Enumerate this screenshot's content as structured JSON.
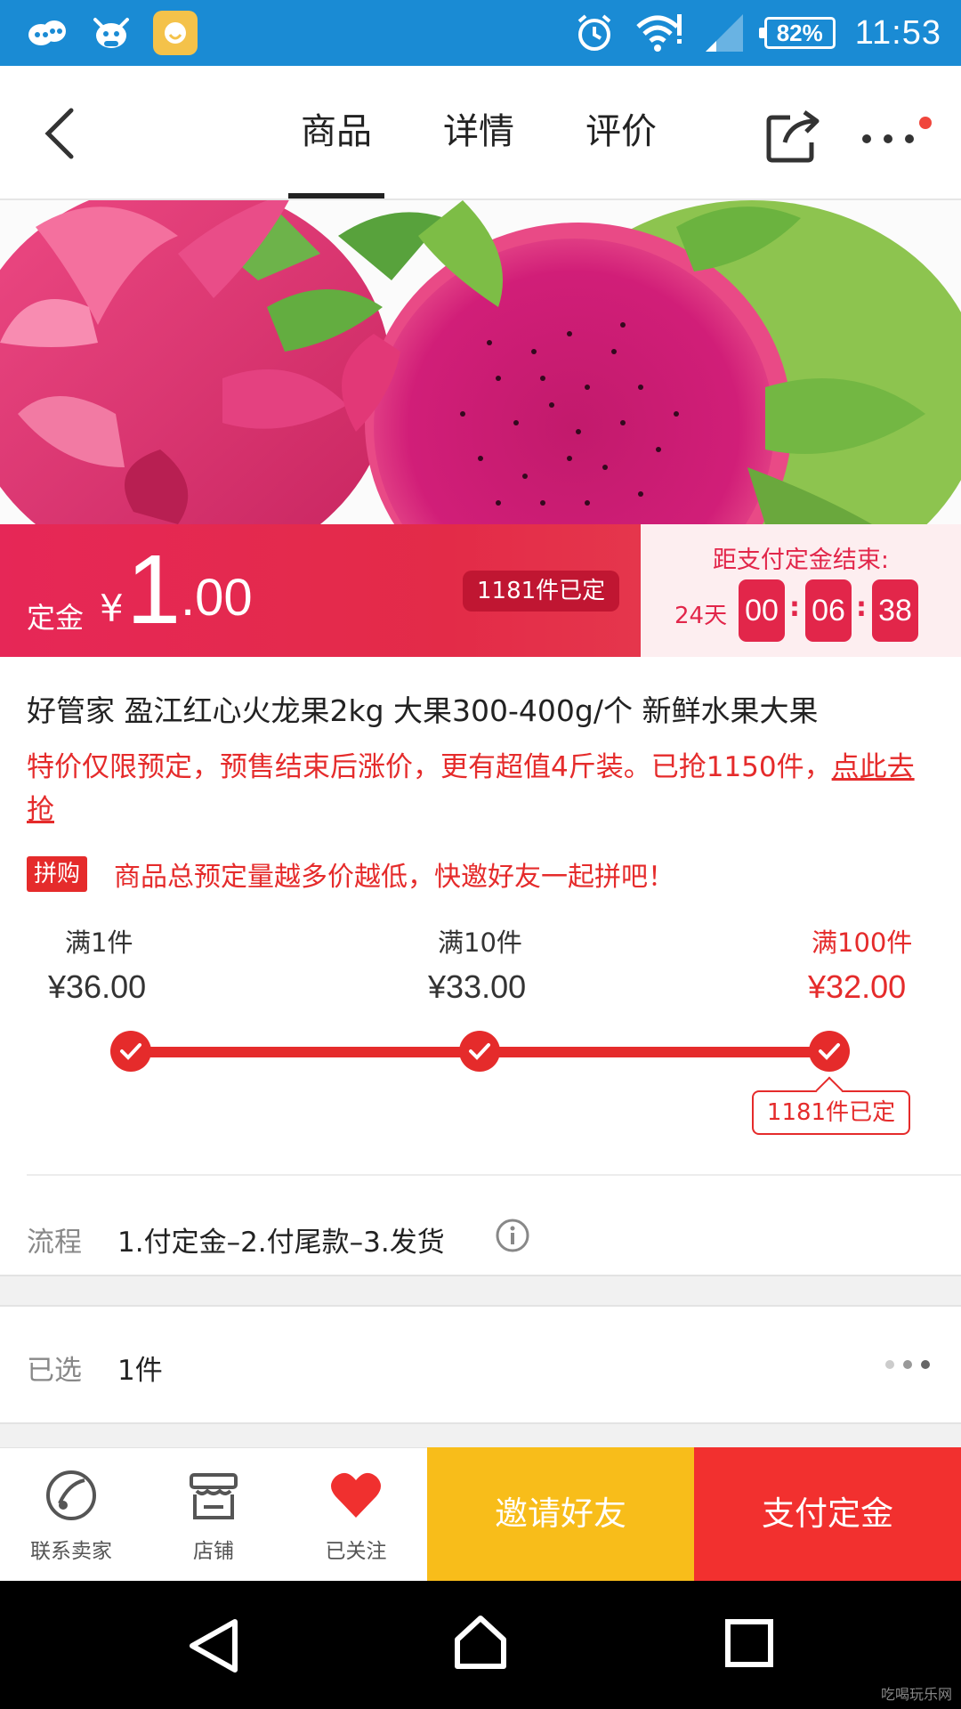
{
  "status_bar": {
    "battery": "82%",
    "time": "11:53"
  },
  "nav": {
    "tabs": [
      {
        "label": "商品",
        "active": true
      },
      {
        "label": "详情",
        "active": false
      },
      {
        "label": "评价",
        "active": false
      }
    ]
  },
  "price": {
    "deposit_label": "定金",
    "currency": "¥",
    "integer": "1",
    "decimal": ".00",
    "booked_badge": "1181件已定"
  },
  "countdown": {
    "title": "距支付定金结束:",
    "days": "24天",
    "hours": "00",
    "minutes": "06",
    "seconds": "38"
  },
  "product": {
    "title": "好管家 盈江红心火龙果2kg 大果300-400g/个 新鲜水果大果",
    "promo_text": "特价仅限预定，预售结束后涨价，更有超值4斤装。已抢1150件，",
    "promo_link": "点此去抢",
    "group_tag": "拼购",
    "group_text": "商品总预定量越多价越低，快邀好友一起拼吧！"
  },
  "tiers": [
    {
      "label": "满1件",
      "price": "¥36.00",
      "reached": true,
      "current": false
    },
    {
      "label": "满10件",
      "price": "¥33.00",
      "reached": true,
      "current": false
    },
    {
      "label": "满100件",
      "price": "¥32.00",
      "reached": true,
      "current": true
    }
  ],
  "tier_bubble": "1181件已定",
  "flow": {
    "label": "流程",
    "value": "1.付定金–2.付尾款–3.发货"
  },
  "selected": {
    "label": "已选",
    "value": "1件"
  },
  "actions": {
    "contact": "联系卖家",
    "store": "店铺",
    "follow": "已关注",
    "invite": "邀请好友",
    "pay": "支付定金"
  },
  "colors": {
    "status_bar": "#1a8bd4",
    "accent_red": "#e52b2b",
    "invite_yellow": "#f8bd1a",
    "pay_red": "#f2302f"
  },
  "watermark": "吃喝玩乐网"
}
